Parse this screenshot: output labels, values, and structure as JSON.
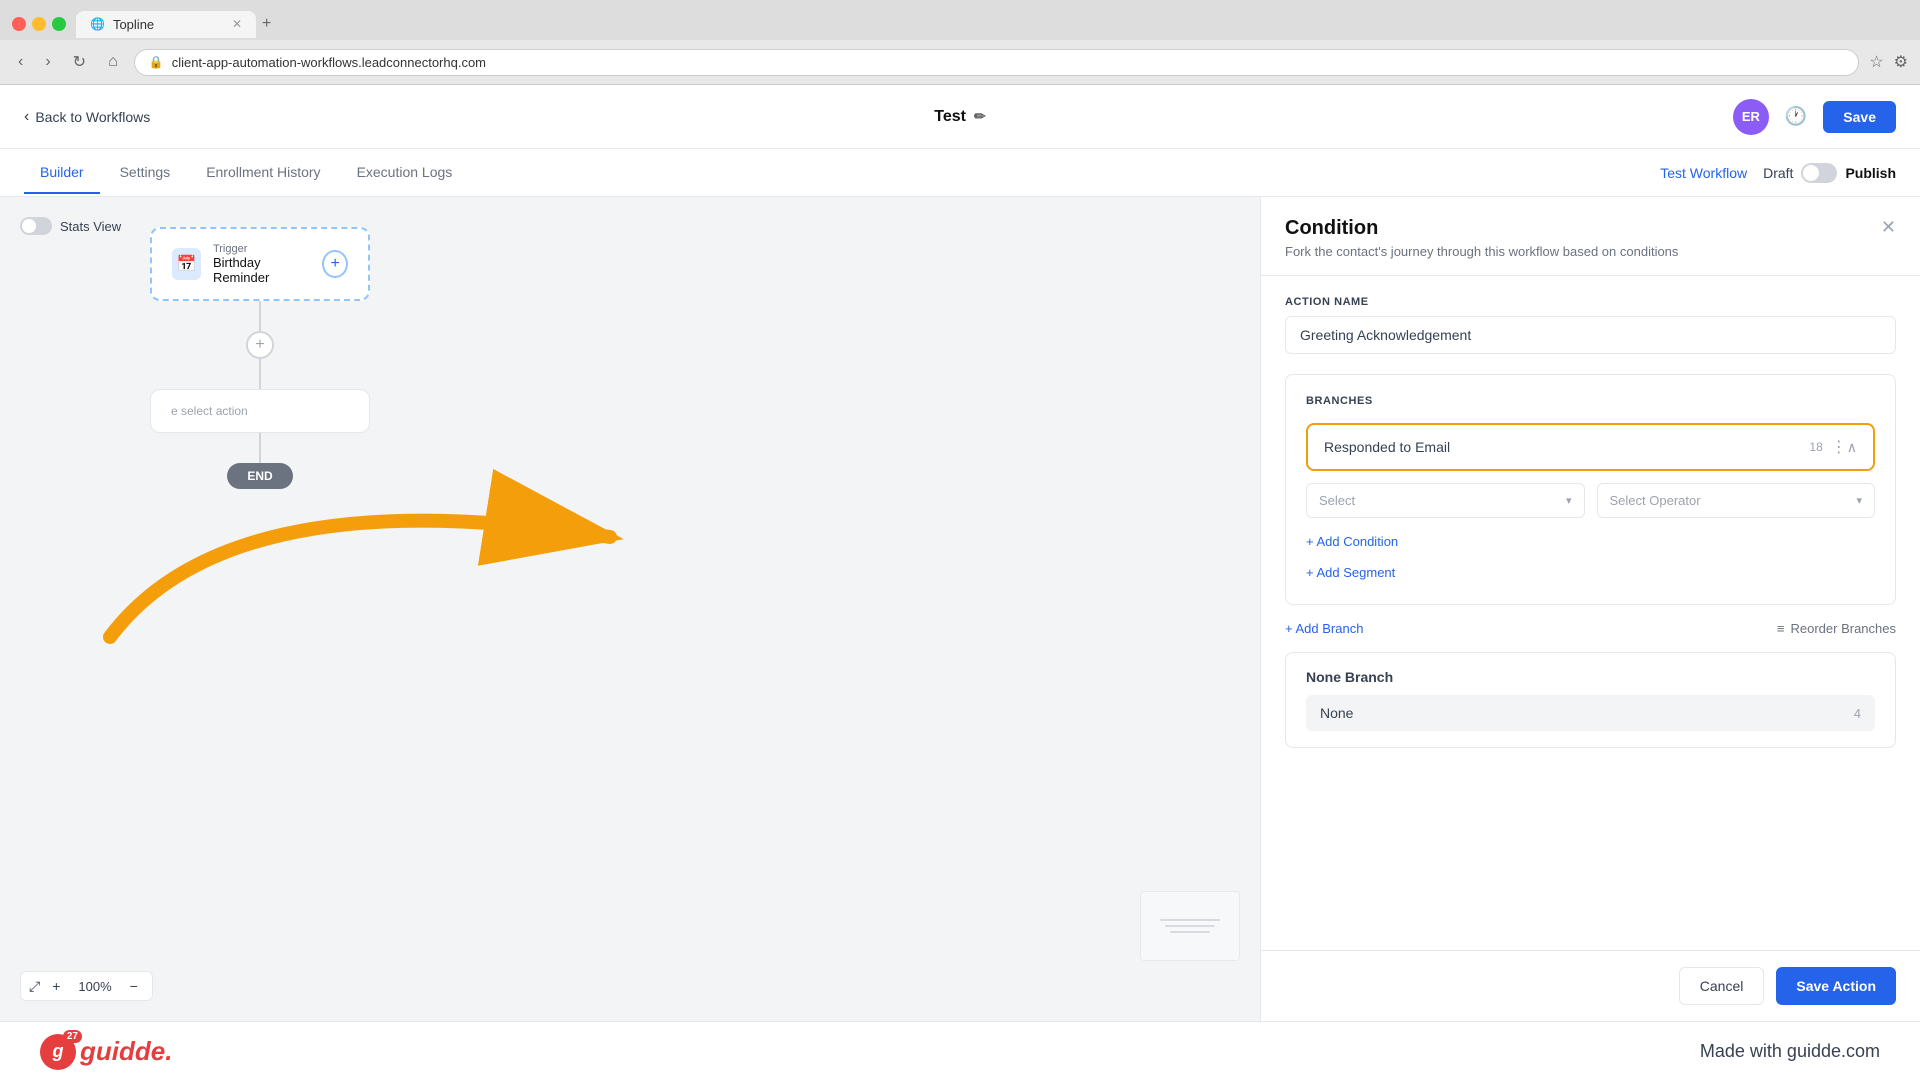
{
  "browser": {
    "tab_title": "Topline",
    "url": "client-app-automation-workflows.leadconnectorhq.com",
    "tab_add": "+"
  },
  "header": {
    "back_label": "Back to Workflows",
    "title": "Test",
    "avatar_initials": "ER",
    "save_label": "Save"
  },
  "nav_tabs": {
    "tabs": [
      {
        "id": "builder",
        "label": "Builder",
        "active": true
      },
      {
        "id": "settings",
        "label": "Settings"
      },
      {
        "id": "enrollment",
        "label": "Enrollment History"
      },
      {
        "id": "execution",
        "label": "Execution Logs"
      }
    ],
    "test_workflow_label": "Test Workflow",
    "draft_label": "Draft",
    "publish_label": "Publish"
  },
  "canvas": {
    "stats_view_label": "Stats View",
    "trigger_label": "Trigger",
    "trigger_name": "Birthday Reminder",
    "select_action_label": "e select action",
    "end_label": "END",
    "zoom_level": "100%"
  },
  "panel": {
    "title": "Condition",
    "subtitle": "Fork the contact's journey through this workflow based on conditions",
    "action_name_label": "ACTION NAME",
    "action_name_value": "Greeting Acknowledgement",
    "branches_label": "BRANCHES",
    "branch_name": "Responded to Email",
    "branch_char_count": "18",
    "select_placeholder": "Select",
    "select_operator_placeholder": "Select Operator",
    "add_condition_label": "+ Add Condition",
    "add_segment_label": "+ Add Segment",
    "add_branch_label": "+ Add Branch",
    "reorder_label": "Reorder Branches",
    "none_branch_title": "None Branch",
    "none_value": "None",
    "none_count": "4",
    "cancel_label": "Cancel",
    "save_action_label": "Save Action"
  },
  "guidde": {
    "logo": "guidde.",
    "badge_count": "27",
    "made_with": "Made with guidde.com"
  }
}
